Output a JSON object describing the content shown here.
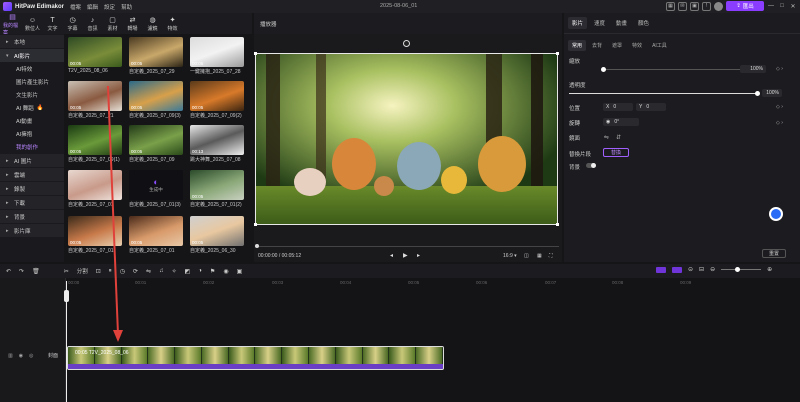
{
  "app": {
    "name": "HitPaw Edimakor",
    "menu": [
      "檔案",
      "編輯",
      "設定",
      "幫助"
    ],
    "doc_title": "2025-08-06_01",
    "export_label": "匯出"
  },
  "media_toolbar": [
    {
      "label": "我的檔案",
      "icon": "folder-icon"
    },
    {
      "label": "數位人",
      "icon": "avatar-icon"
    },
    {
      "label": "文字",
      "icon": "text-icon"
    },
    {
      "label": "字幕",
      "icon": "subtitle-icon"
    },
    {
      "label": "音訊",
      "icon": "music-icon"
    },
    {
      "label": "素材",
      "icon": "asset-icon"
    },
    {
      "label": "轉場",
      "icon": "transition-icon"
    },
    {
      "label": "濾鏡",
      "icon": "filter-icon"
    },
    {
      "label": "特效",
      "icon": "effect-icon"
    }
  ],
  "sidebar": {
    "items": [
      {
        "label": "本地",
        "type": "section"
      },
      {
        "label": "AI影片",
        "type": "section-active"
      },
      {
        "label": "AI特效",
        "type": "sub"
      },
      {
        "label": "圖片產生影片",
        "type": "sub"
      },
      {
        "label": "文生影片",
        "type": "sub"
      },
      {
        "label": "AI 舞蹈",
        "type": "sub",
        "hot": "🔥"
      },
      {
        "label": "AI動畫",
        "type": "sub"
      },
      {
        "label": "AI擁抱",
        "type": "sub"
      },
      {
        "label": "我的創作",
        "type": "sub-active"
      },
      {
        "label": "AI 圖片",
        "type": "section"
      },
      {
        "label": "雲端",
        "type": "section"
      },
      {
        "label": "錄製",
        "type": "section"
      },
      {
        "label": "下載",
        "type": "section"
      },
      {
        "label": "背景",
        "type": "section"
      },
      {
        "label": "影片庫",
        "type": "section"
      }
    ]
  },
  "media_tiles": [
    {
      "label": "T2V_2025_08_06",
      "duration": "00:05"
    },
    {
      "label": "自定義_2025_07_29",
      "duration": "00:05"
    },
    {
      "label": "一鍵擁抱_2025_07_28",
      "duration": "00:05"
    },
    {
      "label": "自定義_2025_07_21",
      "duration": "00:05"
    },
    {
      "label": "自定義_2025_07_09(3)",
      "duration": "00:05"
    },
    {
      "label": "自定義_2025_07_09(2)",
      "duration": "00:05"
    },
    {
      "label": "自定義_2025_07_09(1)",
      "duration": "00:05"
    },
    {
      "label": "自定義_2025_07_09",
      "duration": "00:05"
    },
    {
      "label": "跳大神舞_2025_07_08",
      "duration": "00:13"
    },
    {
      "label": "自定義_2025_07_01",
      "duration": ""
    },
    {
      "label": "自定義_2025_07_01(3)",
      "duration": ""
    },
    {
      "label": "自定義_2025_07_01(2)",
      "duration": "00:05"
    },
    {
      "label": "自定義_2025_07_01",
      "duration": "00:05"
    },
    {
      "label": "自定義_2025_07_01",
      "duration": "00:05"
    },
    {
      "label": "自定義_2025_06_30",
      "duration": "00:05"
    }
  ],
  "processing_label": "生成中",
  "player": {
    "title": "播放器",
    "time_current": "00:00:00",
    "time_total": "00:05:12",
    "ratio": "16:9"
  },
  "properties": {
    "tabs": [
      "影片",
      "速度",
      "動畫",
      "顏色"
    ],
    "sub_tabs": [
      "常用",
      "去背",
      "遮罩",
      "特效",
      "AI工具"
    ],
    "zoom_label": "縮放",
    "zoom_value": "100%",
    "zoom_fraction": 0.0,
    "opacity_label": "透明度",
    "opacity_value": "100%",
    "opacity_fraction": 1.0,
    "position_label": "位置",
    "pos_x_label": "X",
    "pos_x": "0",
    "pos_y_label": "Y",
    "pos_y": "0",
    "rotate_label": "旋轉",
    "rotate_value": "0°",
    "flip_label": "鏡面",
    "replace_label": "替換片段",
    "replace_button": "替換",
    "background_label": "背景",
    "reset_label": "重置"
  },
  "timeline": {
    "split_label": "分割",
    "ruler": [
      "00:00",
      "00:01",
      "00:02",
      "00:03",
      "00:04",
      "00:05",
      "00:06",
      "00:07",
      "00:08",
      "00:09"
    ],
    "cover_label": "封面",
    "clip_label": "00:05 T2V_2025_08_06"
  }
}
